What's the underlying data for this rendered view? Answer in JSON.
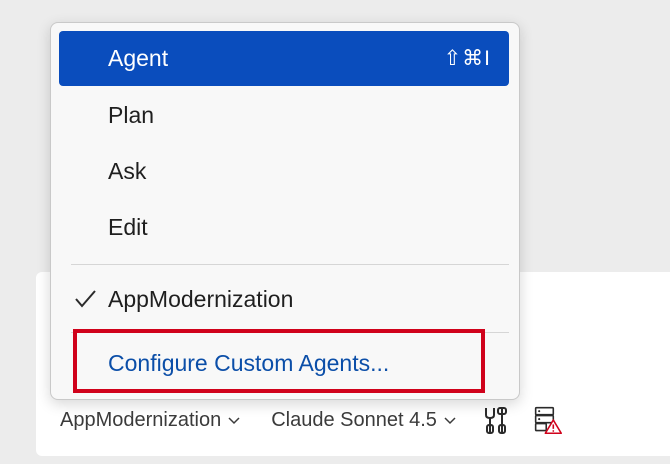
{
  "menu": {
    "items": [
      {
        "label": "Agent",
        "shortcut": "⇧⌘I",
        "selected": true
      },
      {
        "label": "Plan"
      },
      {
        "label": "Ask"
      },
      {
        "label": "Edit"
      }
    ],
    "custom_agent": {
      "label": "AppModernization",
      "checked": true
    },
    "configure": {
      "label": "Configure Custom Agents..."
    }
  },
  "bottom_bar": {
    "agent_picker": "AppModernization",
    "model_picker": "Claude Sonnet 4.5"
  },
  "icons": {
    "tools": "tools-icon",
    "server_warning": "server-warning-icon"
  },
  "colors": {
    "selection": "#0a4dbd",
    "link": "#0b4ea8",
    "highlight": "#d0021b",
    "warning": "#d0021b"
  }
}
